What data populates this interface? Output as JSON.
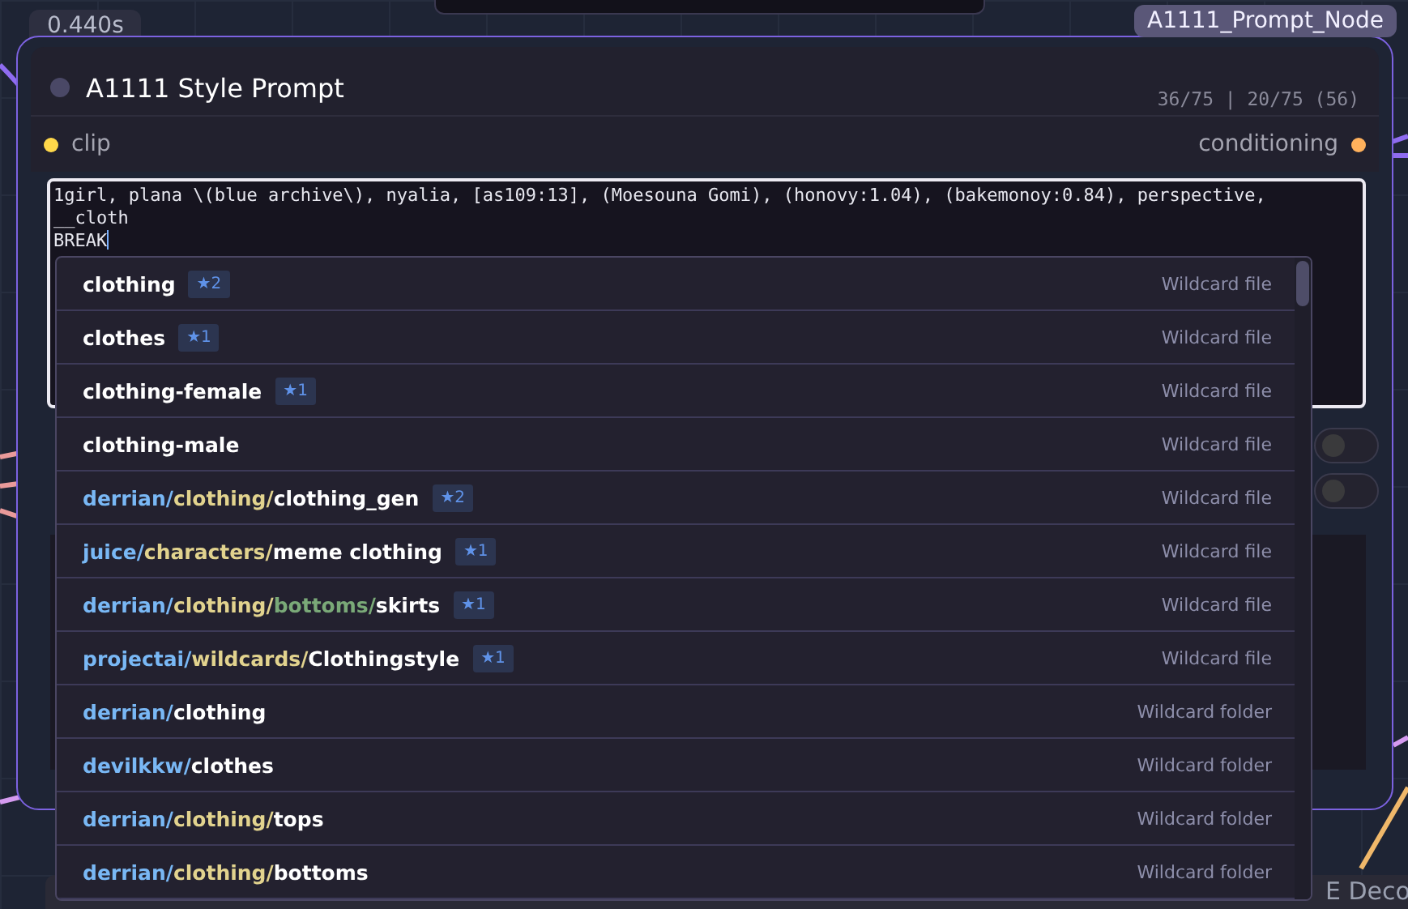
{
  "timing_badge": "0.440s",
  "node_type_badge": "A1111_Prompt_Node",
  "node": {
    "title": "A1111 Style Prompt",
    "token_count": "36/75 | 20/75 (56)",
    "input": {
      "label": "clip",
      "color": "#ffd84a"
    },
    "output": {
      "label": "conditioning",
      "color": "#ffb15c"
    },
    "prompt": {
      "value": "1girl, plana \\(blue archive\\), nyalia, [as109:13], (Moesouna Gomi), (honovy:1.04), (bakemonoy:0.84), perspective,\n__cloth\nBREAK"
    },
    "toggles": [
      {
        "on": false
      },
      {
        "on": false
      }
    ]
  },
  "autocomplete": {
    "items": [
      {
        "segments": [
          {
            "text": "clothing",
            "kind": "name"
          }
        ],
        "badge": "★2",
        "type": "Wildcard file"
      },
      {
        "segments": [
          {
            "text": "clothes",
            "kind": "name"
          }
        ],
        "badge": "★1",
        "type": "Wildcard file"
      },
      {
        "segments": [
          {
            "text": "clothing-female",
            "kind": "name"
          }
        ],
        "badge": "★1",
        "type": "Wildcard file"
      },
      {
        "segments": [
          {
            "text": "clothing-male",
            "kind": "name"
          }
        ],
        "type": "Wildcard file"
      },
      {
        "segments": [
          {
            "text": "derrian/",
            "kind": "root"
          },
          {
            "text": "clothing/",
            "kind": "path"
          },
          {
            "text": "clothing_gen",
            "kind": "name"
          }
        ],
        "badge": "★2",
        "type": "Wildcard file"
      },
      {
        "segments": [
          {
            "text": "juice/",
            "kind": "root"
          },
          {
            "text": "characters/",
            "kind": "path"
          },
          {
            "text": "meme clothing",
            "kind": "name"
          }
        ],
        "badge": "★1",
        "type": "Wildcard file"
      },
      {
        "segments": [
          {
            "text": "derrian/",
            "kind": "root"
          },
          {
            "text": "clothing/",
            "kind": "path"
          },
          {
            "text": "bottoms/",
            "kind": "subpath"
          },
          {
            "text": "skirts",
            "kind": "name"
          }
        ],
        "badge": "★1",
        "type": "Wildcard file"
      },
      {
        "segments": [
          {
            "text": "projectai/",
            "kind": "root"
          },
          {
            "text": "wildcards/",
            "kind": "path"
          },
          {
            "text": "Clothingstyle",
            "kind": "name"
          }
        ],
        "badge": "★1",
        "type": "Wildcard file"
      },
      {
        "segments": [
          {
            "text": "derrian/",
            "kind": "root"
          },
          {
            "text": "clothing",
            "kind": "name"
          }
        ],
        "type": "Wildcard folder"
      },
      {
        "segments": [
          {
            "text": "devilkkw/",
            "kind": "root"
          },
          {
            "text": "clothes",
            "kind": "name"
          }
        ],
        "type": "Wildcard folder"
      },
      {
        "segments": [
          {
            "text": "derrian/",
            "kind": "root"
          },
          {
            "text": "clothing/",
            "kind": "path"
          },
          {
            "text": "tops",
            "kind": "name"
          }
        ],
        "type": "Wildcard folder"
      },
      {
        "segments": [
          {
            "text": "derrian/",
            "kind": "root"
          },
          {
            "text": "clothing/",
            "kind": "path"
          },
          {
            "text": "bottoms",
            "kind": "name"
          }
        ],
        "type": "Wildcard folder"
      }
    ]
  },
  "background_node": {
    "title": "E Deco"
  }
}
